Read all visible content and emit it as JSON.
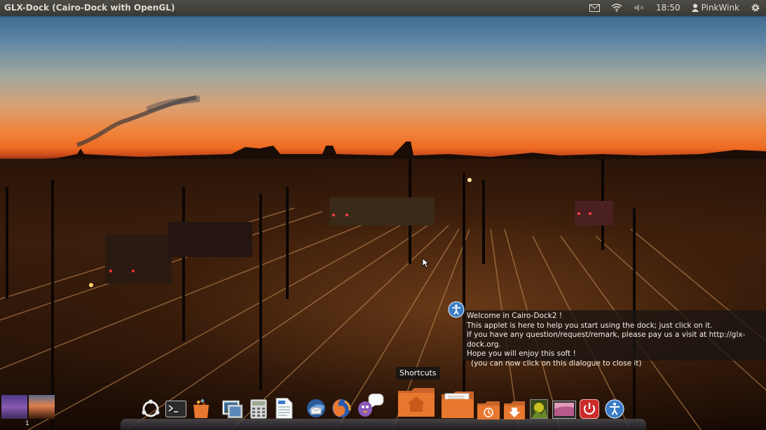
{
  "top_panel": {
    "window_title": "GLX-Dock (Cairo-Dock with OpenGL)",
    "clock": "18:50",
    "username": "PinkWink",
    "icons": [
      "mail-icon",
      "wifi-icon",
      "volume-muted-icon",
      "user-icon",
      "gear-icon"
    ]
  },
  "dialog": {
    "lines": [
      "Welcome in Cairo-Dock2 !",
      "This applet is here to help you start using the dock; just click on it.",
      "If you have any question/request/remark, please pay us a visit at http://glx-dock.org.",
      "Hope you will enjoy this soft !",
      "(you can now click on this dialogue to close it)"
    ]
  },
  "dock": {
    "tooltip": "Shortcuts",
    "icons": [
      "ubuntu-logo-icon",
      "terminal-icon",
      "software-center-icon",
      "image-viewer-icon",
      "calculator-icon",
      "text-document-icon",
      "thunderbird-icon",
      "firefox-icon",
      "pidgin-icon",
      "home-folder-icon",
      "documents-folder-icon",
      "restore-folder-icon",
      "download-folder-icon",
      "image-icon",
      "screenshot-icon",
      "power-icon",
      "accessibility-icon"
    ]
  },
  "workspace": {
    "number": "1"
  },
  "colors": {
    "panel": "#3b3a36",
    "sunset": "#ee6a21",
    "dock_orange": "#e8782f",
    "power_red": "#cc2b2b",
    "accessibility_blue": "#3a7cc7"
  }
}
